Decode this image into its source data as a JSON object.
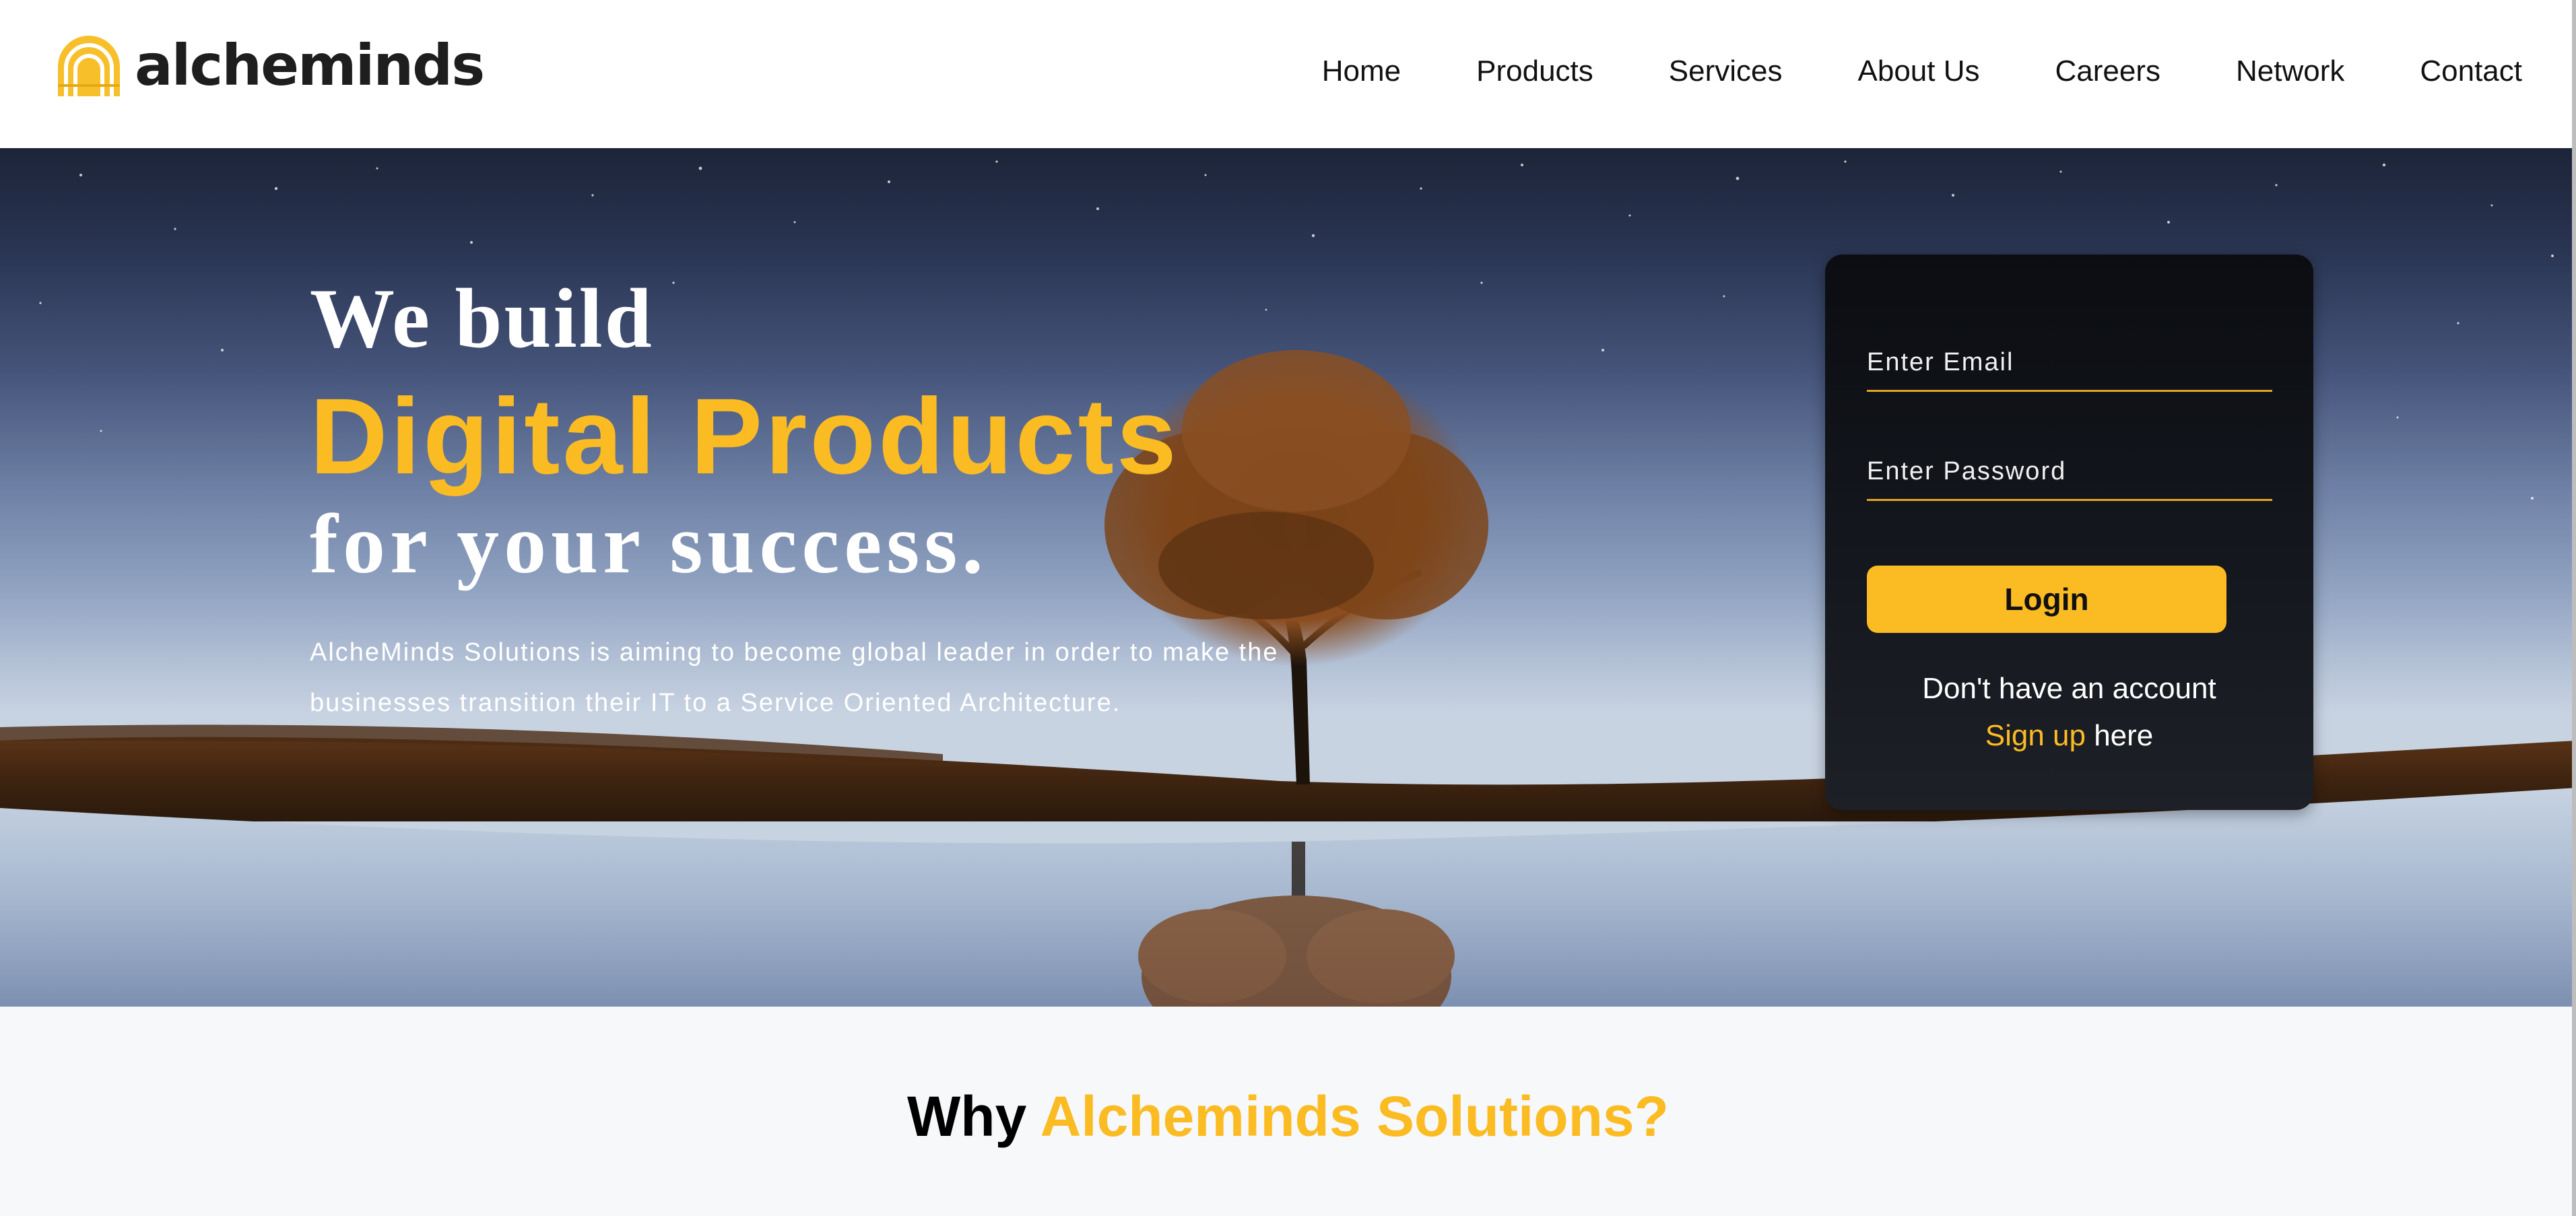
{
  "brand": {
    "name": "alcheminds",
    "accent_color": "#fbbb22"
  },
  "nav": {
    "items": [
      "Home",
      "Products",
      "Services",
      "About Us",
      "Careers",
      "Network",
      "Contact"
    ]
  },
  "hero": {
    "line1": "We build",
    "line2": "Digital Products",
    "line3": "for your success.",
    "description_line1": "AlcheMinds Solutions is aiming to become global leader in order to make the",
    "description_line2": "businesses transition their IT to a Service Oriented Architecture."
  },
  "login": {
    "email_placeholder": "Enter Email",
    "password_placeholder": "Enter Password",
    "login_label": "Login",
    "no_account_text": "Don't have an account",
    "signup_link": "Sign up",
    "signup_suffix": "here"
  },
  "why": {
    "title_prefix": "Why",
    "title_accent": "Alcheminds Solutions?"
  }
}
